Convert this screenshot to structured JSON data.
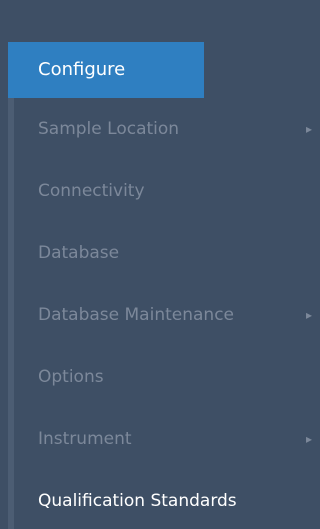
{
  "menu": {
    "header_label": "Configure",
    "items": [
      {
        "label": "Sample Location",
        "submenu": true
      },
      {
        "label": "Connectivity",
        "submenu": false
      },
      {
        "label": "Database",
        "submenu": false
      },
      {
        "label": "Database Maintenance",
        "submenu": true
      },
      {
        "label": "Options",
        "submenu": false
      },
      {
        "label": "Instrument",
        "submenu": true
      },
      {
        "label": "Qualification Standards",
        "submenu": false
      }
    ],
    "chevron_glyph": "▸"
  },
  "colors": {
    "background": "#3e4f65",
    "header_bg": "#2f7fc1",
    "item_text": "#7c889a",
    "active_text": "#ffffff"
  }
}
